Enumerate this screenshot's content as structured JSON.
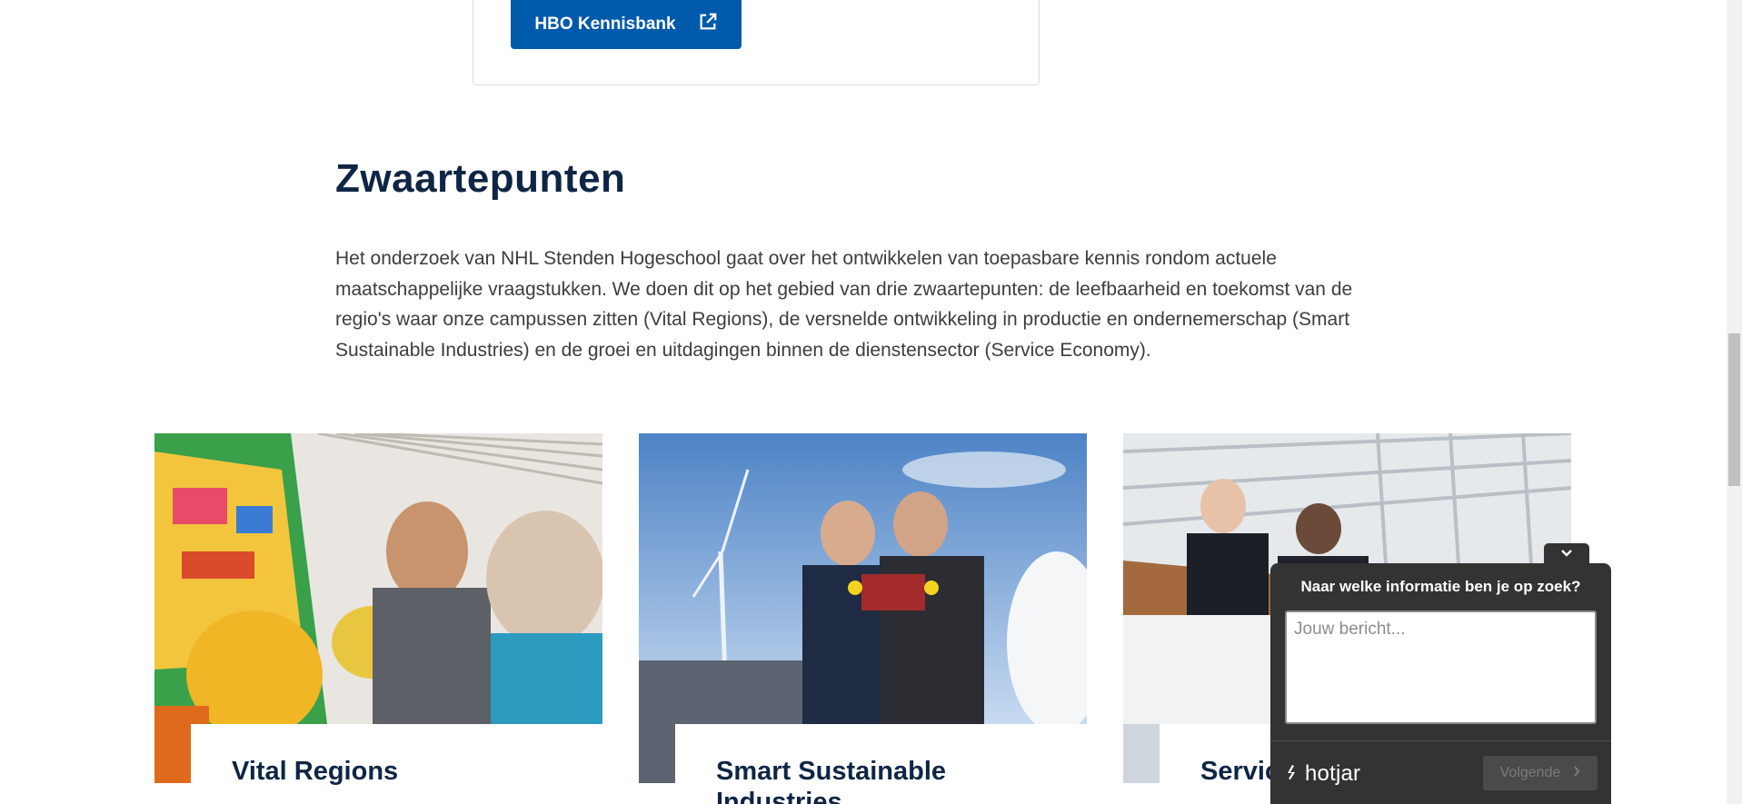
{
  "kennisbank": {
    "button_label": "HBO Kennisbank",
    "icon": "external-link-icon"
  },
  "section": {
    "title": "Zwaartepunten",
    "intro": "Het onderzoek van NHL Stenden Hogeschool gaat over het ontwikkelen van toepasbare kennis rondom actuele maatschappelijke vraagstukken. We doen dit op het gebied van drie zwaartepunten: de leefbaarheid en toekomst van de regio's waar onze campussen zitten (Vital Regions), de versnelde ontwikkeling in productie en ondernemerschap (Smart Sustainable Industries) en de groei en uitdagingen binnen de dienstensector (Service Economy)."
  },
  "cards": [
    {
      "label": "Vital Regions",
      "accent": "#e06a1b"
    },
    {
      "label": "Smart Sustainable Industries",
      "accent": "#5b6470"
    },
    {
      "label": "Service Economy",
      "accent": "#cfd5dc"
    }
  ],
  "hotjar": {
    "question": "Naar welke informatie ben je op zoek?",
    "placeholder": "Jouw bericht...",
    "brand": "hotjar",
    "next_label": "Volgende",
    "toggle_icon": "chevron-down-icon"
  },
  "colors": {
    "primary": "#005aab",
    "heading": "#0f2545",
    "widget_bg": "#333333"
  }
}
